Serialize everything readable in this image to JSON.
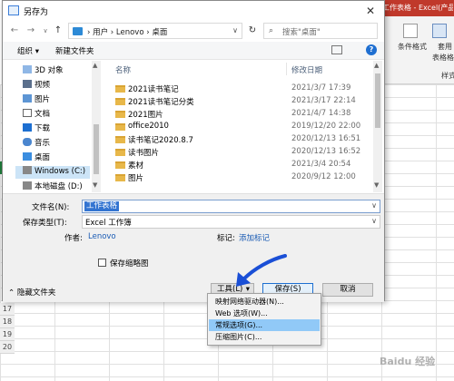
{
  "dialog": {
    "title": "另存为",
    "close_glyph": "✕"
  },
  "nav": {
    "back_glyph": "←",
    "forward_glyph": "→",
    "recent_glyph": "∨",
    "up_glyph": "↑",
    "address": "› 用户 › Lenovo › 桌面",
    "address_drop": "∨",
    "refresh_glyph": "↻",
    "search_placeholder": "搜索\"桌面\""
  },
  "toolbar": {
    "organize": "组织 ▾",
    "new_folder": "新建文件夹",
    "help": "?"
  },
  "tree": {
    "items": [
      {
        "label": "3D 对象",
        "icon": "cube-icon"
      },
      {
        "label": "视频",
        "icon": "video-icon"
      },
      {
        "label": "图片",
        "icon": "picture-icon"
      },
      {
        "label": "文档",
        "icon": "document-icon"
      },
      {
        "label": "下载",
        "icon": "download-icon"
      },
      {
        "label": "音乐",
        "icon": "music-icon"
      },
      {
        "label": "桌面",
        "icon": "desktop-icon"
      },
      {
        "label": "Windows (C:)",
        "icon": "drive-icon"
      },
      {
        "label": "本地磁盘 (D:)",
        "icon": "drive-icon"
      }
    ]
  },
  "filelist": {
    "col_name": "名称",
    "col_date": "修改日期",
    "rows": [
      {
        "name": "2021读书笔记",
        "date": "2021/3/7 17:39"
      },
      {
        "name": "2021读书笔记分类",
        "date": "2021/3/17 22:14"
      },
      {
        "name": "2021图片",
        "date": "2021/4/7 14:38"
      },
      {
        "name": "office2010",
        "date": "2019/12/20 22:00"
      },
      {
        "name": "读书笔记2020.8.7",
        "date": "2020/12/13 16:51"
      },
      {
        "name": "读书图片",
        "date": "2020/12/13 16:52"
      },
      {
        "name": "素材",
        "date": "2021/3/4 20:54"
      },
      {
        "name": "图片",
        "date": "2020/9/12 12:00"
      }
    ]
  },
  "form": {
    "filename_label": "文件名(N):",
    "filename_value": "工作表格",
    "type_label": "保存类型(T):",
    "type_value": "Excel 工作簿",
    "author_label": "作者:",
    "author_value": "Lenovo",
    "tags_label": "标记:",
    "tags_value": "添加标记",
    "thumbnail_label": "保存缩略图",
    "hide_folders": "隐藏文件夹",
    "tools_button": "工具(L)",
    "save_button": "保存(S)",
    "cancel_button": "取消",
    "drop_glyph": "∨"
  },
  "menu": {
    "items": [
      {
        "label": "映射网络驱动器(N)..."
      },
      {
        "label": "Web 选项(W)..."
      },
      {
        "label": "常规选项(G)..."
      },
      {
        "label": "压缩图片(C)..."
      }
    ],
    "highlighted_index": 2
  },
  "excel": {
    "title": "工作表格 - Excel(产品激活失败)",
    "ribbon_items": [
      "条件格式",
      "套用",
      "表格格式"
    ],
    "ribbon_group": "样式",
    "rows": [
      "17",
      "18",
      "19",
      "20"
    ]
  },
  "watermark": "Baidu 经验",
  "colors": {
    "accent": "#1d6fd1",
    "annotation_arrow": "#1a4fd6",
    "excel_red": "#c0392b",
    "excel_green": "#1e7b3b"
  }
}
